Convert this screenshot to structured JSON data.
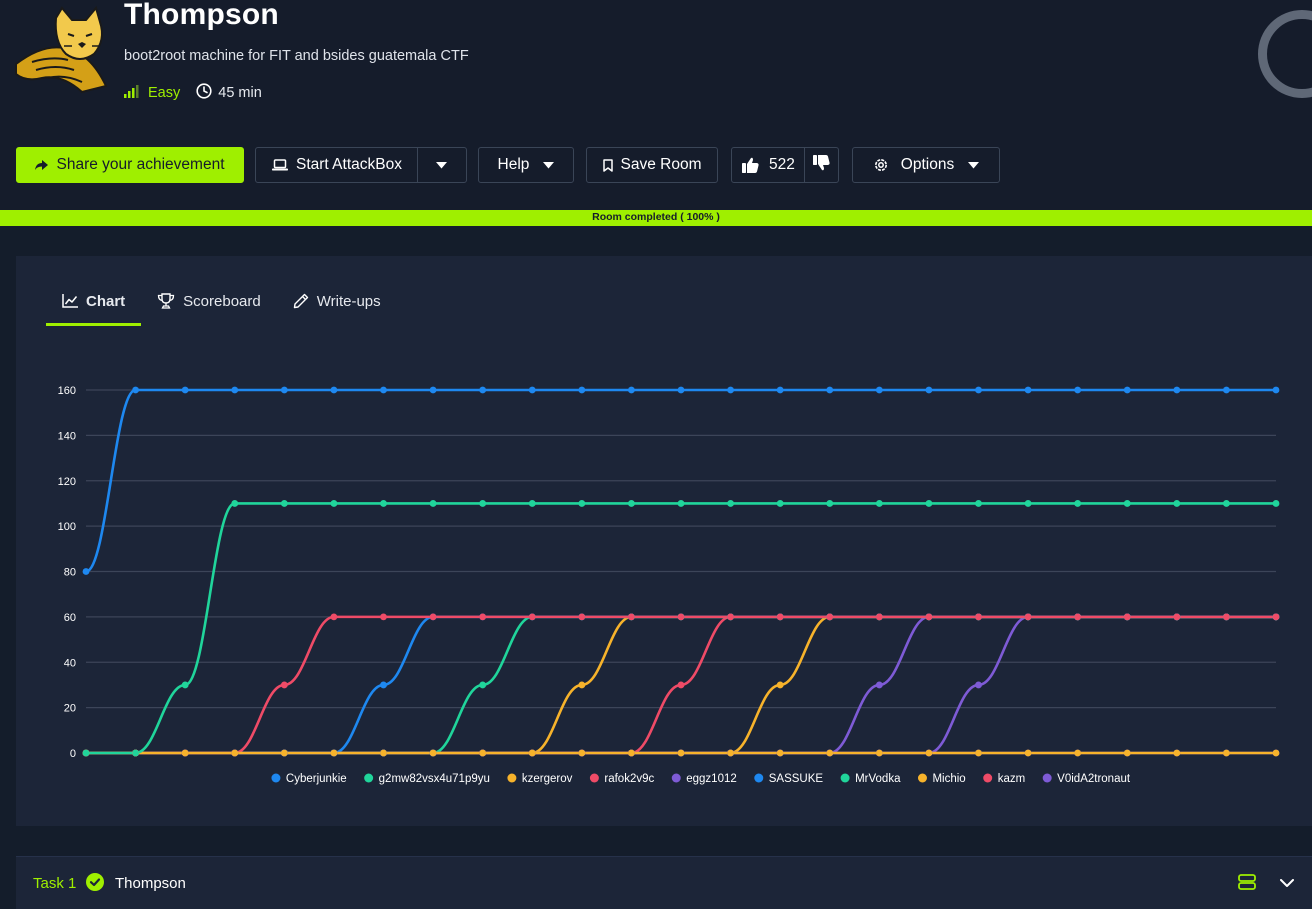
{
  "room": {
    "title": "Thompson",
    "description": "boot2root machine for FIT and bsides guatemala CTF",
    "difficulty": "Easy",
    "duration": "45 min"
  },
  "toolbar": {
    "share_label": "Share your achievement",
    "attackbox_label": "Start AttackBox",
    "help_label": "Help",
    "save_label": "Save Room",
    "likes": "522",
    "options_label": "Options"
  },
  "progress": {
    "label": "Room completed ( 100% )",
    "percent": 100
  },
  "tabs": [
    {
      "label": "Chart",
      "icon": "chart-line-icon",
      "active": true
    },
    {
      "label": "Scoreboard",
      "icon": "trophy-icon",
      "active": false
    },
    {
      "label": "Write-ups",
      "icon": "pen-icon",
      "active": false
    }
  ],
  "chart_data": {
    "type": "line",
    "title": "",
    "xlabel": "",
    "ylabel": "",
    "ylim": [
      0,
      160
    ],
    "yticks": [
      0,
      20,
      40,
      60,
      80,
      100,
      120,
      140,
      160
    ],
    "grid": true,
    "legend_position": "bottom",
    "x": [
      0,
      1,
      2,
      3,
      4,
      5,
      6,
      7,
      8,
      9,
      10,
      11,
      12,
      13,
      14,
      15,
      16,
      17,
      18,
      19,
      20,
      21,
      22,
      23,
      24
    ],
    "series": [
      {
        "name": "Cyberjunkie",
        "color": "#1e88f0",
        "values": [
          80,
          160,
          160,
          160,
          160,
          160,
          160,
          160,
          160,
          160,
          160,
          160,
          160,
          160,
          160,
          160,
          160,
          160,
          160,
          160,
          160,
          160,
          160,
          160,
          160
        ]
      },
      {
        "name": "g2mw82vsx4u71p9yu",
        "color": "#20d59b",
        "values": [
          0,
          0,
          30,
          110,
          110,
          110,
          110,
          110,
          110,
          110,
          110,
          110,
          110,
          110,
          110,
          110,
          110,
          110,
          110,
          110,
          110,
          110,
          110,
          110,
          110
        ]
      },
      {
        "name": "kzergerov",
        "color": "#f7b32b",
        "values": [
          0,
          0,
          0,
          0,
          0,
          0,
          0,
          0,
          0,
          0,
          0,
          0,
          0,
          0,
          0,
          0,
          0,
          0,
          0,
          0,
          0,
          0,
          0,
          0,
          0
        ]
      },
      {
        "name": "rafok2v9c",
        "color": "#ef4b67",
        "values": [
          0,
          0,
          0,
          0,
          30,
          60,
          60,
          60,
          60,
          60,
          60,
          60,
          60,
          60,
          60,
          60,
          60,
          60,
          60,
          60,
          60,
          60,
          60,
          60,
          60
        ]
      },
      {
        "name": "eggz1012",
        "color": "#7e5bd6",
        "values": [
          0,
          0,
          0,
          0,
          0,
          0,
          0,
          0,
          0,
          0,
          0,
          0,
          0,
          0,
          0,
          0,
          0,
          0,
          0,
          0,
          0,
          0,
          0,
          0,
          0
        ]
      },
      {
        "name": "SASSUKE",
        "color": "#1e88f0",
        "values": [
          0,
          0,
          0,
          0,
          0,
          0,
          30,
          60,
          60,
          60,
          60,
          60,
          60,
          60,
          60,
          60,
          60,
          60,
          60,
          60,
          60,
          60,
          60,
          60,
          60
        ]
      },
      {
        "name": "MrVodka",
        "color": "#20d59b",
        "values": [
          0,
          0,
          0,
          0,
          0,
          0,
          0,
          0,
          30,
          60,
          60,
          60,
          60,
          60,
          60,
          60,
          60,
          60,
          60,
          60,
          60,
          60,
          60,
          60,
          60
        ]
      },
      {
        "name": "Michio",
        "color": "#f7b32b",
        "values": [
          0,
          0,
          0,
          0,
          0,
          0,
          0,
          0,
          0,
          0,
          30,
          60,
          60,
          60,
          60,
          60,
          60,
          60,
          60,
          60,
          60,
          60,
          60,
          60,
          60
        ]
      },
      {
        "name": "kazm",
        "color": "#ef4b67",
        "values": [
          0,
          0,
          0,
          0,
          0,
          0,
          0,
          0,
          0,
          0,
          0,
          0,
          30,
          60,
          60,
          60,
          60,
          60,
          60,
          60,
          60,
          60,
          60,
          60,
          60
        ]
      },
      {
        "name": "V0idA2tronaut",
        "color": "#7e5bd6",
        "values": [
          0,
          0,
          0,
          0,
          0,
          0,
          0,
          0,
          0,
          0,
          0,
          0,
          0,
          0,
          0,
          0,
          30,
          60,
          60,
          60,
          60,
          60,
          60,
          60,
          60
        ]
      },
      {
        "name": "",
        "color": "#f7b32b",
        "values": [
          0,
          0,
          0,
          0,
          0,
          0,
          0,
          0,
          0,
          0,
          0,
          0,
          0,
          0,
          30,
          60,
          60,
          60,
          60,
          60,
          60,
          60,
          60,
          60,
          60
        ]
      },
      {
        "name": "",
        "color": "#7e5bd6",
        "values": [
          0,
          0,
          0,
          0,
          0,
          0,
          0,
          0,
          0,
          0,
          0,
          0,
          0,
          0,
          0,
          0,
          0,
          0,
          30,
          60,
          60,
          60,
          60,
          60,
          60
        ]
      }
    ]
  },
  "task": {
    "number_label": "Task 1",
    "title": "Thompson",
    "completed": true
  },
  "colors": {
    "accent": "#9fef00",
    "background": "#141d2b",
    "panel": "#1c2538"
  }
}
